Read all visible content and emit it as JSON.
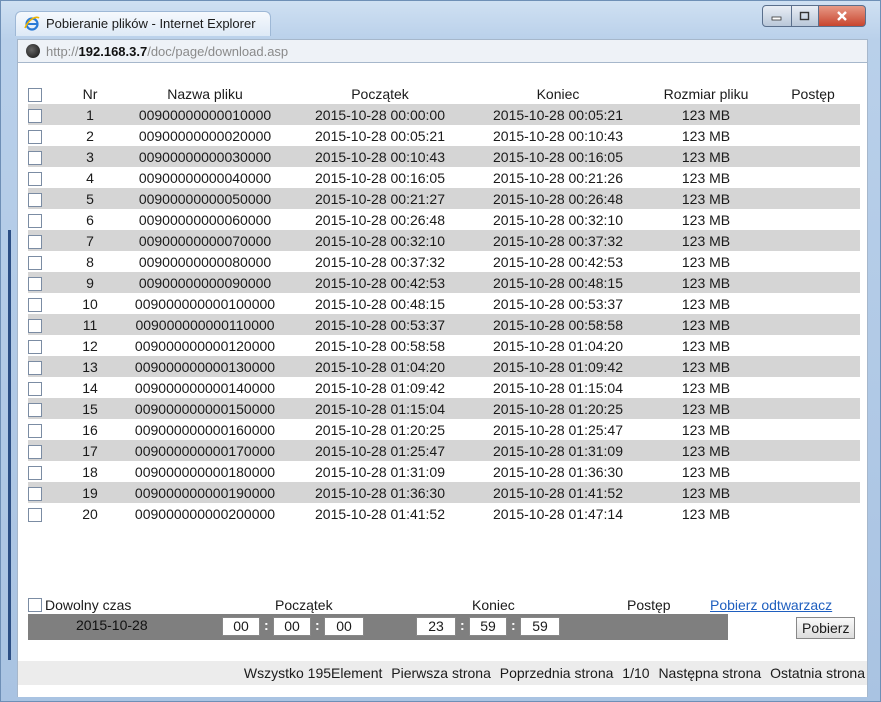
{
  "window": {
    "title": "Pobieranie plików - Internet Explorer"
  },
  "address": {
    "proto": "http://",
    "host": "192.168.3.7",
    "path": "/doc/page/download.asp"
  },
  "table": {
    "headers": {
      "nr": "Nr",
      "name": "Nazwa pliku",
      "start": "Początek",
      "end": "Koniec",
      "size": "Rozmiar pliku",
      "progress": "Postęp"
    },
    "rows": [
      {
        "nr": "1",
        "name": "00900000000010000",
        "start": "2015-10-28 00:00:00",
        "end": "2015-10-28 00:05:21",
        "size": "123 MB"
      },
      {
        "nr": "2",
        "name": "00900000000020000",
        "start": "2015-10-28 00:05:21",
        "end": "2015-10-28 00:10:43",
        "size": "123 MB"
      },
      {
        "nr": "3",
        "name": "00900000000030000",
        "start": "2015-10-28 00:10:43",
        "end": "2015-10-28 00:16:05",
        "size": "123 MB"
      },
      {
        "nr": "4",
        "name": "00900000000040000",
        "start": "2015-10-28 00:16:05",
        "end": "2015-10-28 00:21:26",
        "size": "123 MB"
      },
      {
        "nr": "5",
        "name": "00900000000050000",
        "start": "2015-10-28 00:21:27",
        "end": "2015-10-28 00:26:48",
        "size": "123 MB"
      },
      {
        "nr": "6",
        "name": "00900000000060000",
        "start": "2015-10-28 00:26:48",
        "end": "2015-10-28 00:32:10",
        "size": "123 MB"
      },
      {
        "nr": "7",
        "name": "00900000000070000",
        "start": "2015-10-28 00:32:10",
        "end": "2015-10-28 00:37:32",
        "size": "123 MB"
      },
      {
        "nr": "8",
        "name": "00900000000080000",
        "start": "2015-10-28 00:37:32",
        "end": "2015-10-28 00:42:53",
        "size": "123 MB"
      },
      {
        "nr": "9",
        "name": "00900000000090000",
        "start": "2015-10-28 00:42:53",
        "end": "2015-10-28 00:48:15",
        "size": "123 MB"
      },
      {
        "nr": "10",
        "name": "009000000000100000",
        "start": "2015-10-28 00:48:15",
        "end": "2015-10-28 00:53:37",
        "size": "123 MB"
      },
      {
        "nr": "11",
        "name": "009000000000110000",
        "start": "2015-10-28 00:53:37",
        "end": "2015-10-28 00:58:58",
        "size": "123 MB"
      },
      {
        "nr": "12",
        "name": "009000000000120000",
        "start": "2015-10-28 00:58:58",
        "end": "2015-10-28 01:04:20",
        "size": "123 MB"
      },
      {
        "nr": "13",
        "name": "009000000000130000",
        "start": "2015-10-28 01:04:20",
        "end": "2015-10-28 01:09:42",
        "size": "123 MB"
      },
      {
        "nr": "14",
        "name": "009000000000140000",
        "start": "2015-10-28 01:09:42",
        "end": "2015-10-28 01:15:04",
        "size": "123 MB"
      },
      {
        "nr": "15",
        "name": "009000000000150000",
        "start": "2015-10-28 01:15:04",
        "end": "2015-10-28 01:20:25",
        "size": "123 MB"
      },
      {
        "nr": "16",
        "name": "009000000000160000",
        "start": "2015-10-28 01:20:25",
        "end": "2015-10-28 01:25:47",
        "size": "123 MB"
      },
      {
        "nr": "17",
        "name": "009000000000170000",
        "start": "2015-10-28 01:25:47",
        "end": "2015-10-28 01:31:09",
        "size": "123 MB"
      },
      {
        "nr": "18",
        "name": "009000000000180000",
        "start": "2015-10-28 01:31:09",
        "end": "2015-10-28 01:36:30",
        "size": "123 MB"
      },
      {
        "nr": "19",
        "name": "009000000000190000",
        "start": "2015-10-28 01:36:30",
        "end": "2015-10-28 01:41:52",
        "size": "123 MB"
      },
      {
        "nr": "20",
        "name": "009000000000200000",
        "start": "2015-10-28 01:41:52",
        "end": "2015-10-28 01:47:14",
        "size": "123 MB"
      }
    ]
  },
  "filter": {
    "anytime_label": "Dowolny czas",
    "start_label": "Początek",
    "end_label": "Koniec",
    "progress_label": "Postęp",
    "player_link": "Pobierz odtwarzacz",
    "date": "2015-10-28",
    "start_h": "00",
    "start_m": "00",
    "start_s": "00",
    "end_h": "23",
    "end_m": "59",
    "end_s": "59",
    "download_button": "Pobierz",
    "colon": ":"
  },
  "pager": {
    "total": "Wszystko 195Element",
    "first": "Pierwsza strona",
    "prev": "Poprzednia strona",
    "page": "1/10",
    "next": "Następna strona",
    "last": "Ostatnia strona"
  }
}
